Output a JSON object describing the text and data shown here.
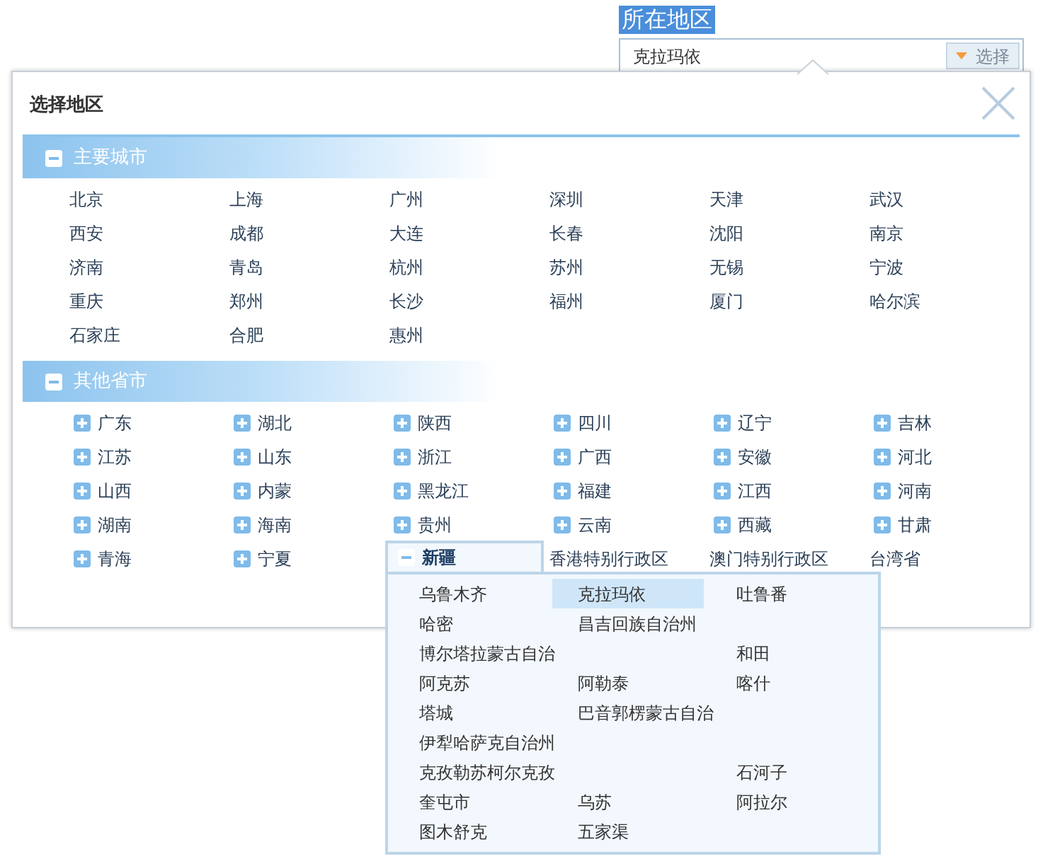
{
  "field": {
    "label": "所在地区",
    "value": "克拉玛依",
    "button": "选择"
  },
  "dialog": {
    "title": "选择地区"
  },
  "sections": [
    {
      "title": "主要城市",
      "expanded": true,
      "kind": "cities",
      "items": [
        {
          "name": "北京"
        },
        {
          "name": "上海"
        },
        {
          "name": "广州"
        },
        {
          "name": "深圳"
        },
        {
          "name": "天津"
        },
        {
          "name": "武汉"
        },
        {
          "name": "西安"
        },
        {
          "name": "成都"
        },
        {
          "name": "大连"
        },
        {
          "name": "长春"
        },
        {
          "name": "沈阳"
        },
        {
          "name": "南京"
        },
        {
          "name": "济南"
        },
        {
          "name": "青岛"
        },
        {
          "name": "杭州"
        },
        {
          "name": "苏州"
        },
        {
          "name": "无锡"
        },
        {
          "name": "宁波"
        },
        {
          "name": "重庆"
        },
        {
          "name": "郑州"
        },
        {
          "name": "长沙"
        },
        {
          "name": "福州"
        },
        {
          "name": "厦门"
        },
        {
          "name": "哈尔滨"
        },
        {
          "name": "石家庄"
        },
        {
          "name": "合肥"
        },
        {
          "name": "惠州"
        }
      ]
    },
    {
      "title": "其他省市",
      "expanded": true,
      "kind": "provinces",
      "items": [
        {
          "name": "广东",
          "kind": "expandable",
          "expanded": false
        },
        {
          "name": "湖北",
          "kind": "expandable",
          "expanded": false
        },
        {
          "name": "陕西",
          "kind": "expandable",
          "expanded": false
        },
        {
          "name": "四川",
          "kind": "expandable",
          "expanded": false
        },
        {
          "name": "辽宁",
          "kind": "expandable",
          "expanded": false
        },
        {
          "name": "吉林",
          "kind": "expandable",
          "expanded": false
        },
        {
          "name": "江苏",
          "kind": "expandable",
          "expanded": false
        },
        {
          "name": "山东",
          "kind": "expandable",
          "expanded": false
        },
        {
          "name": "浙江",
          "kind": "expandable",
          "expanded": false
        },
        {
          "name": "广西",
          "kind": "expandable",
          "expanded": false
        },
        {
          "name": "安徽",
          "kind": "expandable",
          "expanded": false
        },
        {
          "name": "河北",
          "kind": "expandable",
          "expanded": false
        },
        {
          "name": "山西",
          "kind": "expandable",
          "expanded": false
        },
        {
          "name": "内蒙",
          "kind": "expandable",
          "expanded": false
        },
        {
          "name": "黑龙江",
          "kind": "expandable",
          "expanded": false
        },
        {
          "name": "福建",
          "kind": "expandable",
          "expanded": false
        },
        {
          "name": "江西",
          "kind": "expandable",
          "expanded": false
        },
        {
          "name": "河南",
          "kind": "expandable",
          "expanded": false
        },
        {
          "name": "湖南",
          "kind": "expandable",
          "expanded": false
        },
        {
          "name": "海南",
          "kind": "expandable",
          "expanded": false
        },
        {
          "name": "贵州",
          "kind": "expandable",
          "expanded": false
        },
        {
          "name": "云南",
          "kind": "expandable",
          "expanded": false
        },
        {
          "name": "西藏",
          "kind": "expandable",
          "expanded": false
        },
        {
          "name": "甘肃",
          "kind": "expandable",
          "expanded": false
        },
        {
          "name": "青海",
          "kind": "expandable",
          "expanded": false
        },
        {
          "name": "宁夏",
          "kind": "expandable",
          "expanded": false
        },
        {
          "name": "新疆",
          "kind": "expandable",
          "expanded": true,
          "children": [
            {
              "name": "乌鲁木齐",
              "selected": false
            },
            {
              "name": "克拉玛依",
              "selected": true
            },
            {
              "name": "吐鲁番",
              "selected": false
            },
            {
              "name": "哈密",
              "selected": false
            },
            {
              "name": "昌吉回族自治州",
              "selected": false
            },
            {
              "name": "博尔塔拉蒙古自治",
              "selected": false
            },
            {
              "name": "和田",
              "selected": false
            },
            {
              "name": "阿克苏",
              "selected": false
            },
            {
              "name": "阿勒泰",
              "selected": false
            },
            {
              "name": "喀什",
              "selected": false
            },
            {
              "name": "塔城",
              "selected": false
            },
            {
              "name": "巴音郭楞蒙古自治",
              "selected": false
            },
            {
              "name": "伊犁哈萨克自治州",
              "selected": false
            },
            {
              "name": "克孜勒苏柯尔克孜",
              "selected": false
            },
            {
              "name": "石河子",
              "selected": false
            },
            {
              "name": "奎屯市",
              "selected": false
            },
            {
              "name": "乌苏",
              "selected": false
            },
            {
              "name": "阿拉尔",
              "selected": false
            },
            {
              "name": "图木舒克",
              "selected": false
            },
            {
              "name": "五家渠",
              "selected": false
            }
          ]
        },
        {
          "name": "香港特别行政区",
          "kind": "plain"
        },
        {
          "name": "澳门特别行政区",
          "kind": "plain"
        },
        {
          "name": "台湾省",
          "kind": "plain"
        }
      ]
    }
  ]
}
